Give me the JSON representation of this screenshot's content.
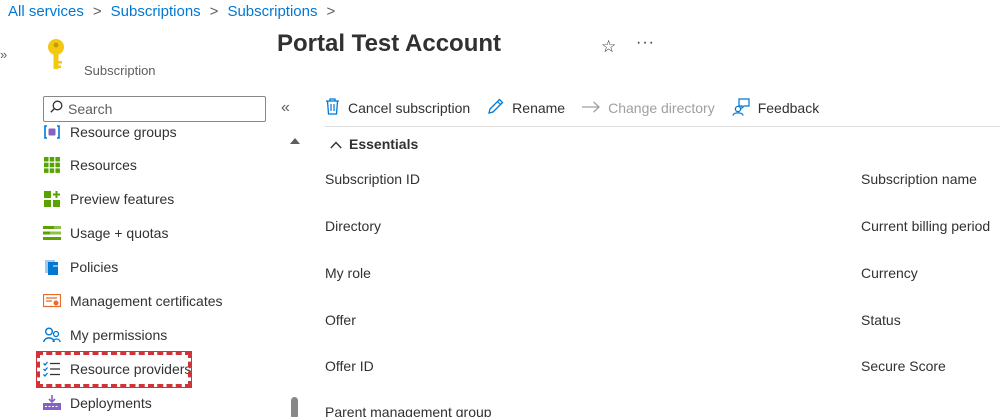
{
  "breadcrumb": {
    "items": [
      "All services",
      "Subscriptions",
      "Subscriptions"
    ],
    "separator": ">"
  },
  "edge_toggle": "»",
  "resource": {
    "title": "Portal Test Account",
    "subtitle": "Subscription",
    "icon": "key-icon",
    "more": "···"
  },
  "search": {
    "placeholder": "Search",
    "value": ""
  },
  "collapse_glyph": "«",
  "nav": {
    "items": [
      {
        "label": "Resource groups",
        "icon": "resource-groups-icon"
      },
      {
        "label": "Resources",
        "icon": "resources-grid-icon"
      },
      {
        "label": "Preview features",
        "icon": "preview-features-icon"
      },
      {
        "label": "Usage + quotas",
        "icon": "usage-quotas-icon"
      },
      {
        "label": "Policies",
        "icon": "policies-icon"
      },
      {
        "label": "Management certificates",
        "icon": "certificate-icon"
      },
      {
        "label": "My permissions",
        "icon": "permissions-icon"
      },
      {
        "label": "Resource providers",
        "icon": "resource-providers-icon"
      },
      {
        "label": "Deployments",
        "icon": "deployments-icon"
      }
    ]
  },
  "commands": {
    "cancel": "Cancel subscription",
    "rename": "Rename",
    "change_directory": "Change directory",
    "feedback": "Feedback"
  },
  "essentials": {
    "title": "Essentials",
    "left": [
      "Subscription ID",
      "Directory",
      "My role",
      "Offer",
      "Offer ID",
      "Parent management group"
    ],
    "right": [
      "Subscription name",
      "Current billing period",
      "Currency",
      "Status",
      "Secure Score"
    ]
  },
  "colors": {
    "link": "#0078d4",
    "highlight": "#d13438",
    "key": "#f2c811"
  }
}
